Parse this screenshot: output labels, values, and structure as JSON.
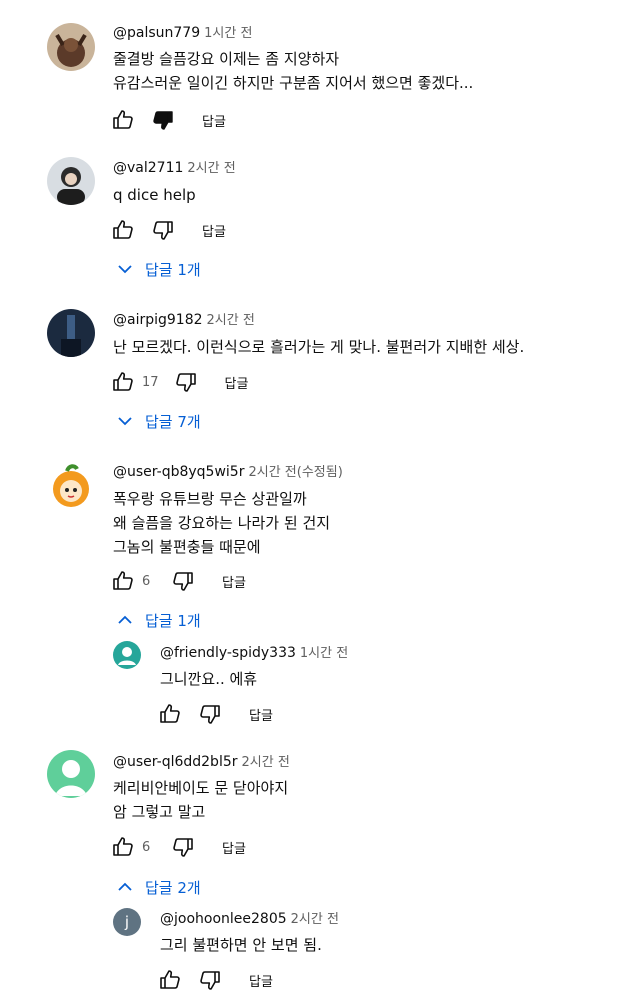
{
  "comments": [
    {
      "author": "@palsun779",
      "time": "1시간 전",
      "lines": [
        "줄결방 슬픔강요 이제는 좀 지양하자",
        "유감스러운 일이긴 하지만 구분좀 지어서 했으면 좋겠다..."
      ],
      "likes": "",
      "disliked": true,
      "reply_label": "답글"
    },
    {
      "author": "@val2711",
      "time": "2시간 전",
      "lines": [
        "q dice help"
      ],
      "likes": "",
      "reply_label": "답글",
      "replies_toggle": "답글 1개"
    },
    {
      "author": "@airpig9182",
      "time": "2시간 전",
      "lines": [
        "난 모르겠다. 이런식으로 흘러가는 게 맞나. 불편러가 지배한 세상."
      ],
      "likes": "17",
      "reply_label": "답글",
      "replies_toggle": "답글 7개"
    },
    {
      "author": "@user-qb8yq5wi5r",
      "time": "2시간 전(수정됨)",
      "lines": [
        "폭우랑 유튜브랑 무슨 상관일까",
        "왜 슬픔을 강요하는 나라가 된 건지",
        "그놈의 불편충들 때문에"
      ],
      "likes": "6",
      "reply_label": "답글",
      "replies_toggle": "답글 1개",
      "reply": {
        "author": "@friendly-spidy333",
        "time": "1시간 전",
        "lines": [
          "그니깐요.. 에휴"
        ],
        "reply_label": "답글"
      }
    },
    {
      "author": "@user-ql6dd2bl5r",
      "time": "2시간 전",
      "lines": [
        "케리비안베이도 문 닫아야지",
        "암 그렇고 말고"
      ],
      "likes": "6",
      "reply_label": "답글",
      "replies_toggle": "답글 2개",
      "reply": {
        "author": "@joohoonlee2805",
        "time": "2시간 전",
        "lines": [
          "그리 불편하면 안 보면 됨."
        ],
        "avatar_letter": "j",
        "reply_label": "답글"
      }
    }
  ],
  "colors": {
    "link": "#065fd4",
    "meta": "#606060",
    "text": "#0f0f0f"
  },
  "icons": [
    "thumb-up-icon",
    "thumb-down-icon",
    "chevron-down-icon",
    "chevron-up-icon"
  ]
}
